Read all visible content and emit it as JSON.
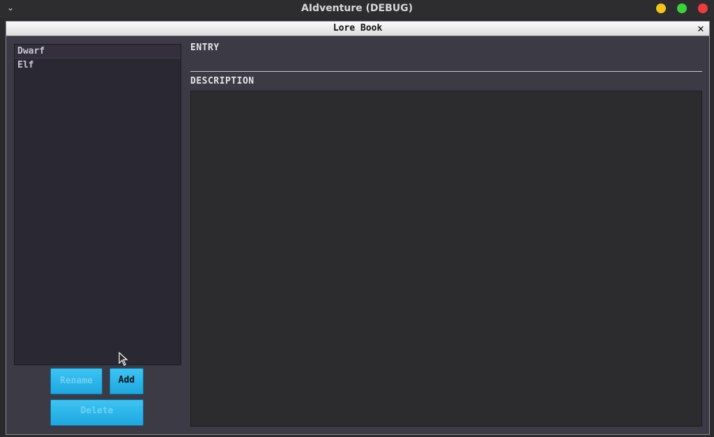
{
  "os_window": {
    "title": "AIdventure (DEBUG)",
    "chevron": "⌄",
    "buttons": {
      "minimize_color": "#f5c518",
      "maximize_color": "#3ad33a",
      "close_color": "#ef3b3b"
    }
  },
  "dialog": {
    "title": "Lore Book",
    "close_glyph": "✕"
  },
  "entries": {
    "items": [
      {
        "label": "Dwarf",
        "selected": true
      },
      {
        "label": "Elf",
        "selected": false
      }
    ]
  },
  "buttons": {
    "rename_label": "Rename",
    "add_label": "Add",
    "delete_label": "Delete",
    "accent_color": "#1ea7e0"
  },
  "form": {
    "entry_label": "ENTRY",
    "entry_value": "",
    "description_label": "DESCRIPTION",
    "description_value": ""
  },
  "icons": {
    "chevron": "chevron-down-icon",
    "close": "close-icon",
    "cursor": "mouse-pointer-icon"
  }
}
